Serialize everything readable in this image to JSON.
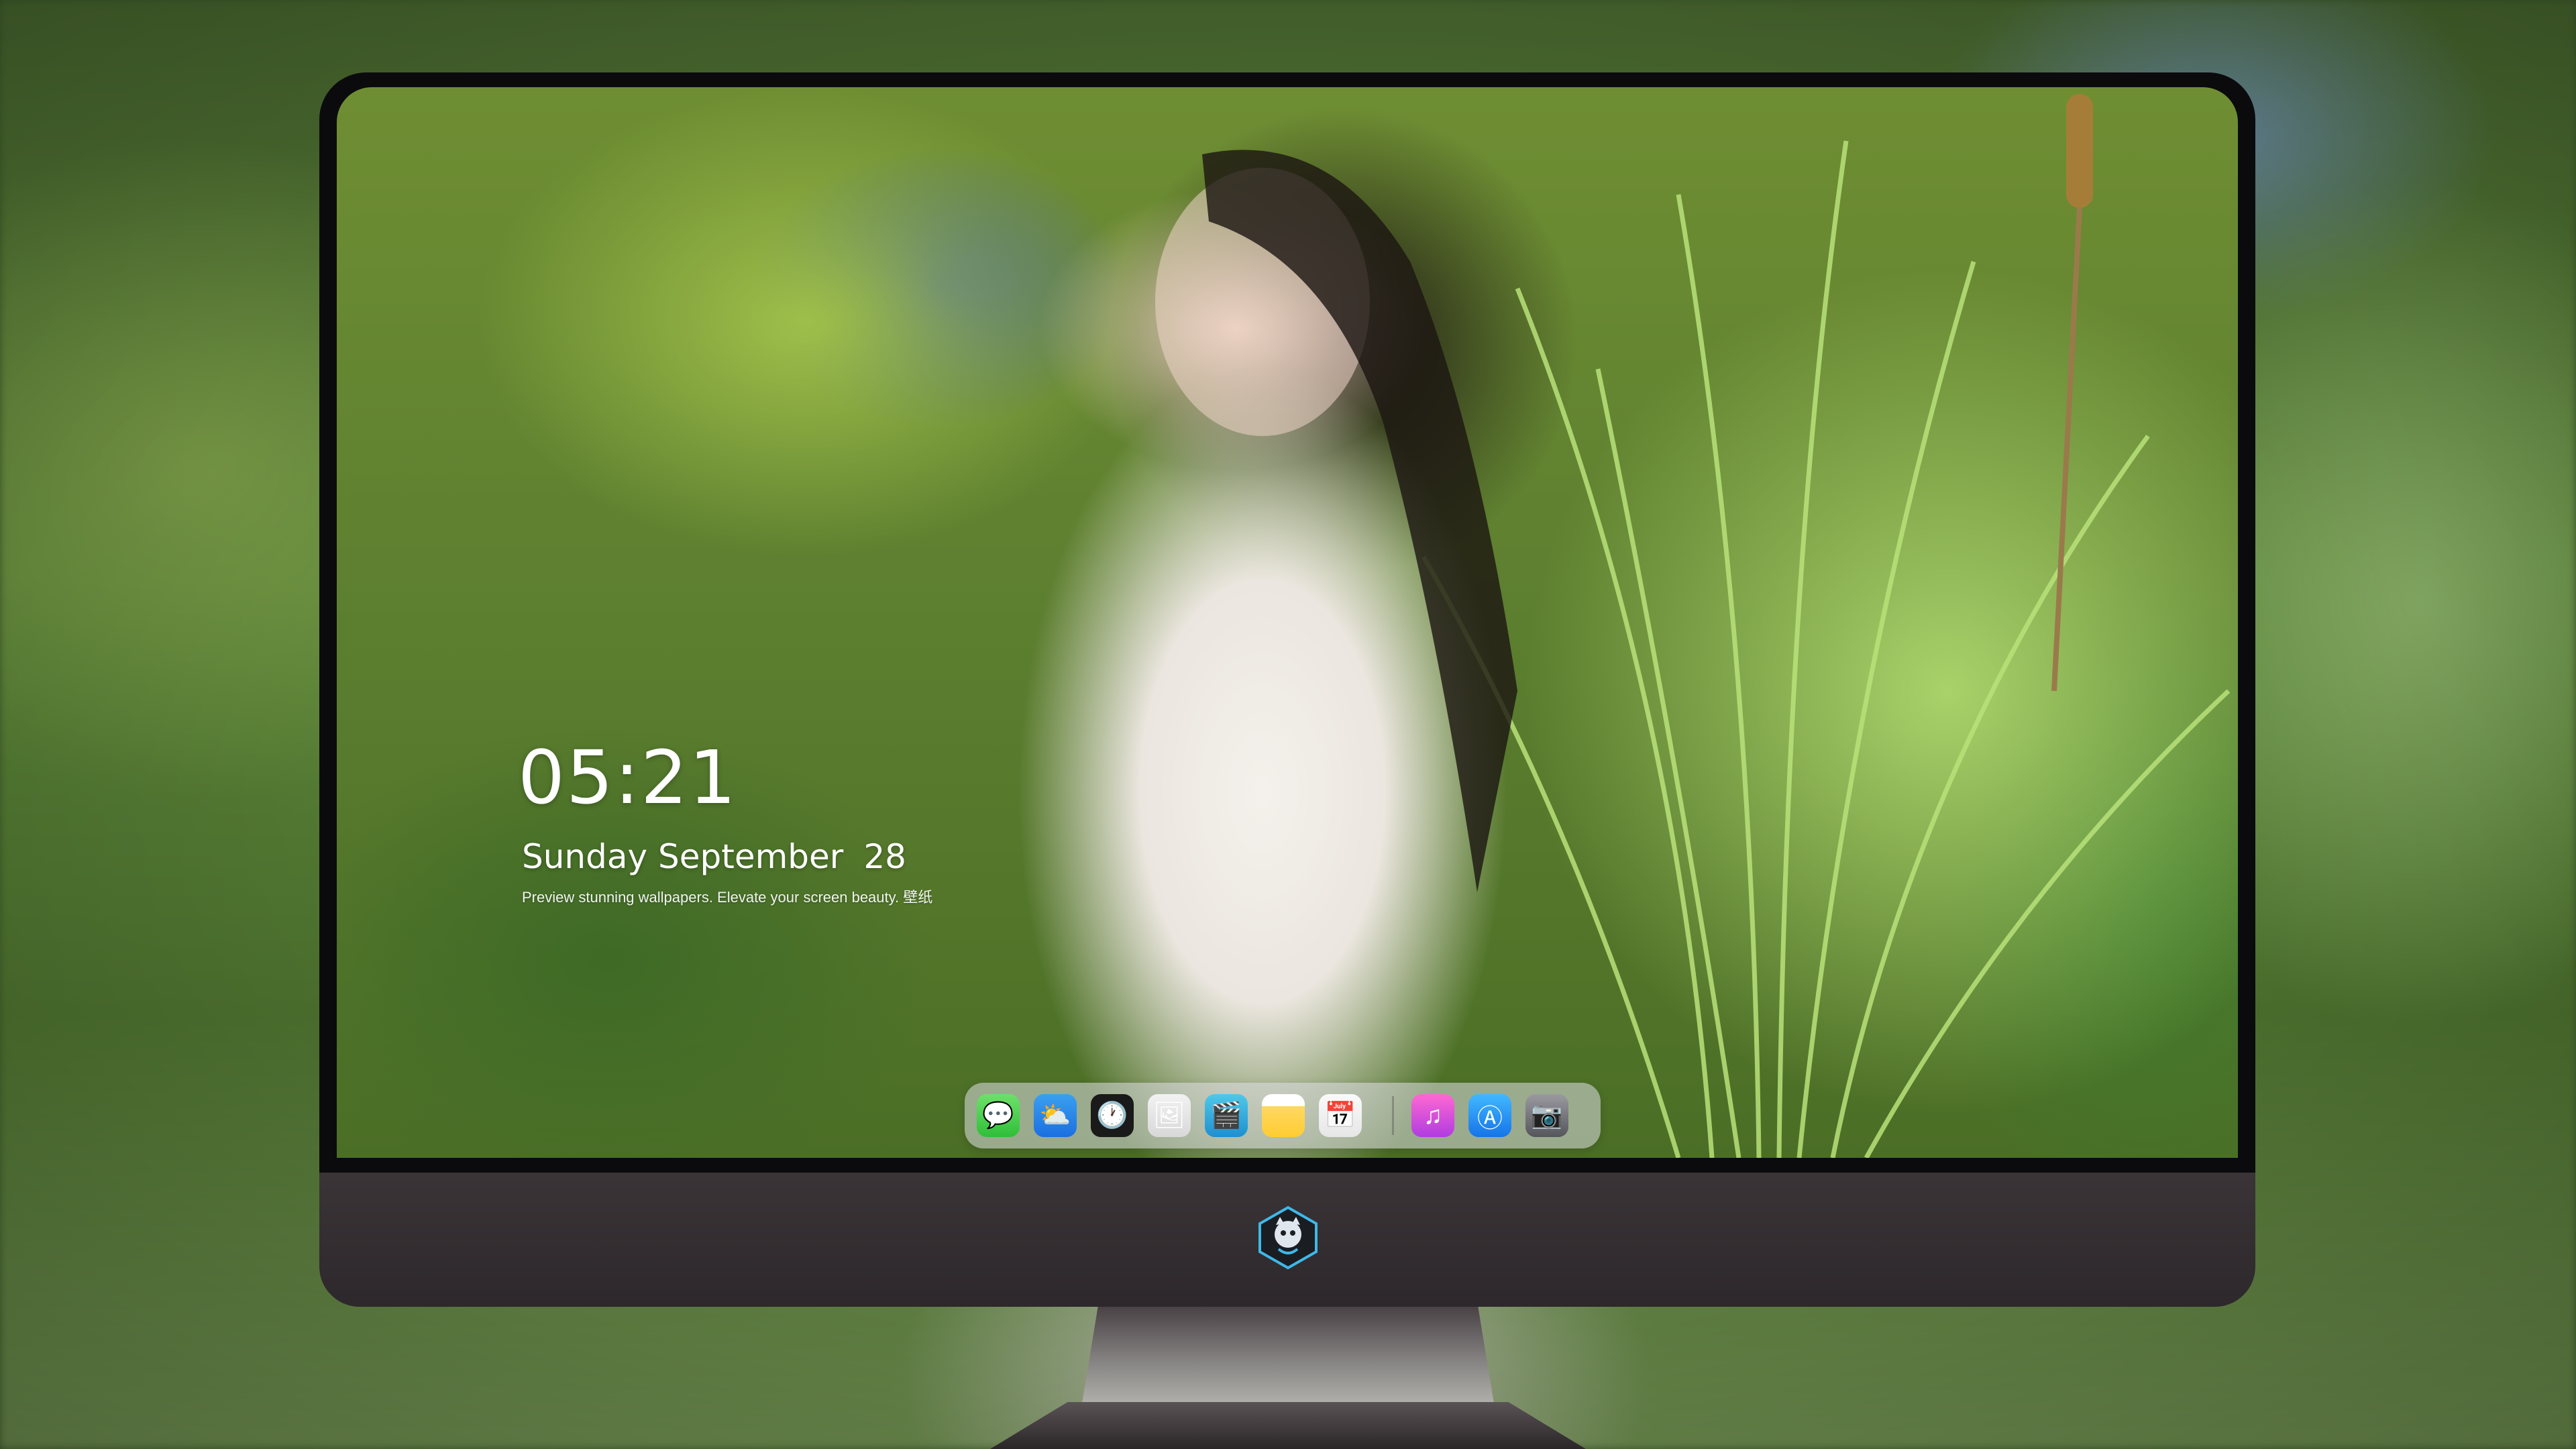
{
  "lock_screen": {
    "time": "05:21",
    "date_text": "Sunday September",
    "date_day": "28",
    "caption": "Preview stunning wallpapers. Elevate your screen beauty. 壁纸"
  },
  "dock": {
    "apps": [
      {
        "name": "messages",
        "icon": "messages-icon",
        "glyph": "💬"
      },
      {
        "name": "weather",
        "icon": "weather-icon",
        "glyph": "⛅"
      },
      {
        "name": "clock",
        "icon": "clock-icon",
        "glyph": "🕐"
      },
      {
        "name": "preview",
        "icon": "preview-icon",
        "glyph": "🖼"
      },
      {
        "name": "video",
        "icon": "video-icon",
        "glyph": "🎬"
      },
      {
        "name": "notes",
        "icon": "notes-icon",
        "glyph": ""
      },
      {
        "name": "photos",
        "icon": "photos-icon",
        "glyph": "📅"
      },
      {
        "name": "music",
        "icon": "music-icon",
        "glyph": "♫"
      },
      {
        "name": "app store",
        "icon": "app-store-icon",
        "glyph": "Ⓐ"
      },
      {
        "name": "camera",
        "icon": "camera-icon",
        "glyph": "📷"
      }
    ]
  },
  "colors": {
    "monitor_bezel": "#0b0b0d",
    "monitor_chin": "#3a3437",
    "dock_background": "rgba(220,220,225,0.55)"
  }
}
